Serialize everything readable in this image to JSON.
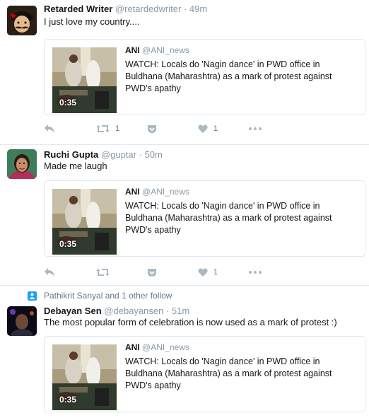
{
  "tweets": [
    {
      "name": "Retarded Writer",
      "handle": "@retardedwriter",
      "time": "49m",
      "text": "I just love my country....",
      "card": {
        "name": "ANI",
        "handle": "@ANI_news",
        "text": "WATCH: Locals do 'Nagin dance' in PWD office in Buldhana (Maharashtra) as a mark of protest against PWD's apathy",
        "duration": "0:35"
      },
      "retweet_count": "1",
      "like_count": "1"
    },
    {
      "name": "Ruchi Gupta",
      "handle": "@guptar",
      "time": "50m",
      "text": "Made me laugh",
      "card": {
        "name": "ANI",
        "handle": "@ANI_news",
        "text": "WATCH: Locals do 'Nagin dance' in PWD office in Buldhana (Maharashtra) as a mark of protest against PWD's apathy",
        "duration": "0:35"
      },
      "retweet_count": "",
      "like_count": "1"
    },
    {
      "context": "Pathikrit Sanyal and 1 other follow",
      "name": "Debayan Sen",
      "handle": "@debayansen",
      "time": "51m",
      "text": "The most popular form of celebration is now used as a mark of protest :)",
      "card": {
        "name": "ANI",
        "handle": "@ANI_news",
        "text": "WATCH: Locals do 'Nagin dance' in PWD office in Buldhana (Maharashtra) as a mark of protest against PWD's apathy",
        "duration": "0:35"
      }
    }
  ],
  "separator": "·",
  "icons": [
    "reply-icon",
    "retweet-icon",
    "pocket-icon",
    "heart-icon",
    "more-icon",
    "follow-context-icon"
  ],
  "colors": {
    "muted": "#8899a6",
    "action": "#aab8c2",
    "border": "#e1e8ed",
    "accent": "#1da1f2"
  }
}
